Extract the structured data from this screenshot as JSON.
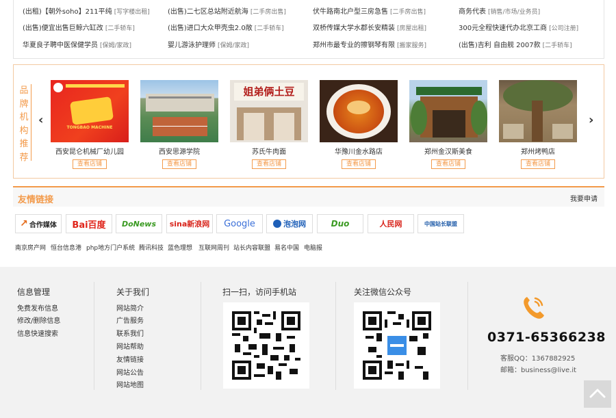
{
  "listings": [
    {
      "text": "(出租)【朝外soho】211平纯",
      "tag": "[写字楼出租]"
    },
    {
      "text": "(出售)二七区总站附近航海",
      "tag": "[二手房出售]"
    },
    {
      "text": "伏牛路南北户型三房急售",
      "tag": "[二手房出售]"
    },
    {
      "text": "商务代表",
      "tag": "[销售/市场/业务员]"
    },
    {
      "text": "(出售)便宜出售巨鲸六缸改",
      "tag": "[二手轿车]"
    },
    {
      "text": "(出售)进口大众甲壳虫2.0敞",
      "tag": "[二手轿车]"
    },
    {
      "text": "双桥传媒大学水郡长安精装",
      "tag": "[房屋出租]"
    },
    {
      "text": "300元全程快速代办北京工商",
      "tag": "[公司注册]"
    },
    {
      "text": "华夏良子聘中医保健学员",
      "tag": "[保姆/家政]"
    },
    {
      "text": "婴儿游泳护理师",
      "tag": "[保姆/家政]"
    },
    {
      "text": "郑州市最专业的擦钢琴有限",
      "tag": "[搬家服务]"
    },
    {
      "text": "(出售)吉利 自由舰 2007款",
      "tag": "[二手轿车]"
    }
  ],
  "brand": {
    "title": [
      "品",
      "牌",
      "机",
      "构",
      "推",
      "荐"
    ],
    "prev_arrow": "‹",
    "next_arrow": "›",
    "button_label": "查看店铺",
    "image_banner": "TONGBAO MACHINE",
    "image_sign": "姐弟俩土豆",
    "items": [
      {
        "name": "西安昆仑机械厂幼儿园"
      },
      {
        "name": "西安思源学院"
      },
      {
        "name": "苏氏牛肉面"
      },
      {
        "name": "华豫川金水路店"
      },
      {
        "name": "郑州金汉斯美食"
      },
      {
        "name": "郑州烤鸭店"
      }
    ]
  },
  "friend_links": {
    "title": "友情链接",
    "apply": "我要申请",
    "logos": [
      "合作媒体",
      "Bai百度",
      "DoNews",
      "sina新浪网",
      "Google",
      "泡泡网",
      "Duo",
      "人民网",
      "中国站长联盟"
    ],
    "texts": [
      "南京房产网",
      "恒台信息港",
      "php地方门户系统",
      "腾讯科技",
      "蓝色理想",
      "互联网周刊",
      "站长内容联盟",
      "易名中国",
      "电脑报"
    ]
  },
  "footer": {
    "info_title": "信息管理",
    "info_links": [
      "免费发布信息",
      "修改/删除信息",
      "信息快速搜索"
    ],
    "about_title": "关于我们",
    "about_links": [
      "网站简介",
      "广告服务",
      "联系我们",
      "网站帮助",
      "友情链接",
      "网站公告",
      "网站地图"
    ],
    "mobile_title": "扫一扫，访问手机站",
    "wechat_title": "关注微信公众号",
    "phone": "0371-65366238",
    "qq": "客服QQ：1367882925",
    "email": "邮箱：business@live.it"
  },
  "colors": {
    "accent": "#f39a4a",
    "phone_icon": "#f39a2c"
  }
}
